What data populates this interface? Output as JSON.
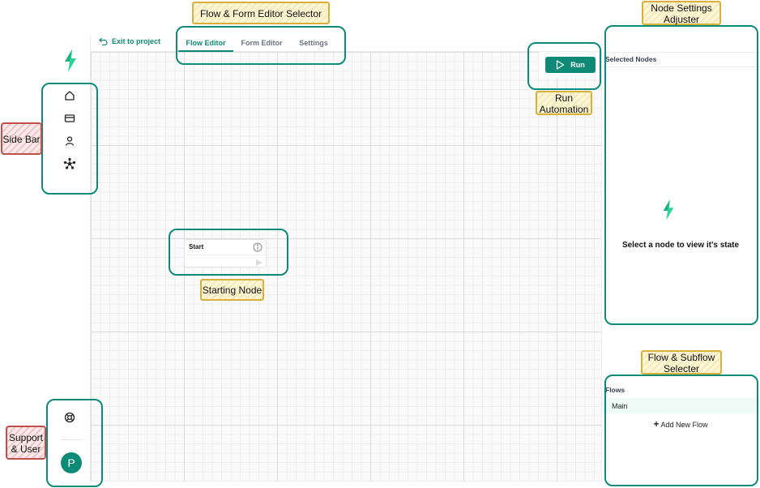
{
  "topbar": {
    "exit_label": "Exit to project",
    "tabs": [
      {
        "label": "Flow Editor",
        "active": true
      },
      {
        "label": "Form Editor",
        "active": false
      },
      {
        "label": "Settings",
        "active": false
      }
    ],
    "run_label": "Run"
  },
  "sidebar": {
    "items": [
      {
        "icon": "home-icon"
      },
      {
        "icon": "credit-card-icon"
      },
      {
        "icon": "user-icon"
      },
      {
        "icon": "integrations-icon"
      }
    ],
    "support_icon": "lifebuoy-icon",
    "avatar_letter": "P"
  },
  "canvas": {
    "start_node": {
      "title": "Start"
    }
  },
  "right_panel": {
    "selected_title": "Selected Nodes",
    "empty_message": "Select a node to view it's state",
    "flows_title": "Flows",
    "flows": [
      {
        "label": "Main"
      }
    ],
    "add_flow_label": "Add New Flow"
  },
  "annotations": {
    "flow_form_selector": "Flow & Form Editor Selector",
    "node_settings": "Node Settings Adjuster",
    "run_automation": "Run Automation",
    "side_bar": "Side Bar",
    "starting_node": "Starting Node",
    "flow_subflow": "Flow & Subflow Selecter",
    "support_user": "Support & User"
  },
  "colors": {
    "accent": "#0f8a77",
    "highlight_border": "#0e8a78",
    "label_yellow": "#d9b13a",
    "label_red": "#c0504d"
  }
}
